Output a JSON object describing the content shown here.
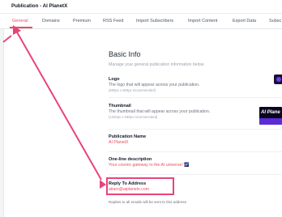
{
  "header": {
    "title": "Publication - AI PlanetX"
  },
  "tabs": [
    {
      "label": "General",
      "active": true
    },
    {
      "label": "Domains"
    },
    {
      "label": "Premium"
    },
    {
      "label": "RSS Feed"
    },
    {
      "label": "Import Subscribers"
    },
    {
      "label": "Import Content"
    },
    {
      "label": "Export Data"
    },
    {
      "label": "Subsc"
    }
  ],
  "basic_info": {
    "title": "Basic Info",
    "subtitle": "Manage your general publication information below."
  },
  "logo": {
    "label": "Logo",
    "description": "The logo that will appear across your publication.",
    "hint": "(800px x 800px recommended)"
  },
  "thumbnail": {
    "label": "Thumbnail",
    "description": "The thumbnail that will appear across your publication.",
    "hint": "(1200px x 630px recommended)",
    "image_text": "AI Plane"
  },
  "publication_name": {
    "label": "Publication Name",
    "value": "AI PlanetX"
  },
  "one_line": {
    "label": "One-line description",
    "value": "Your cosmic gateway to the AI universe! 🌌"
  },
  "reply_to": {
    "label": "Reply To Address",
    "value": "aitam@aiplanetx.com",
    "note": "Replies to all emails will be sent to this address"
  },
  "colors": {
    "accent": "#ef4b5f",
    "annotation": "#e8447a"
  }
}
